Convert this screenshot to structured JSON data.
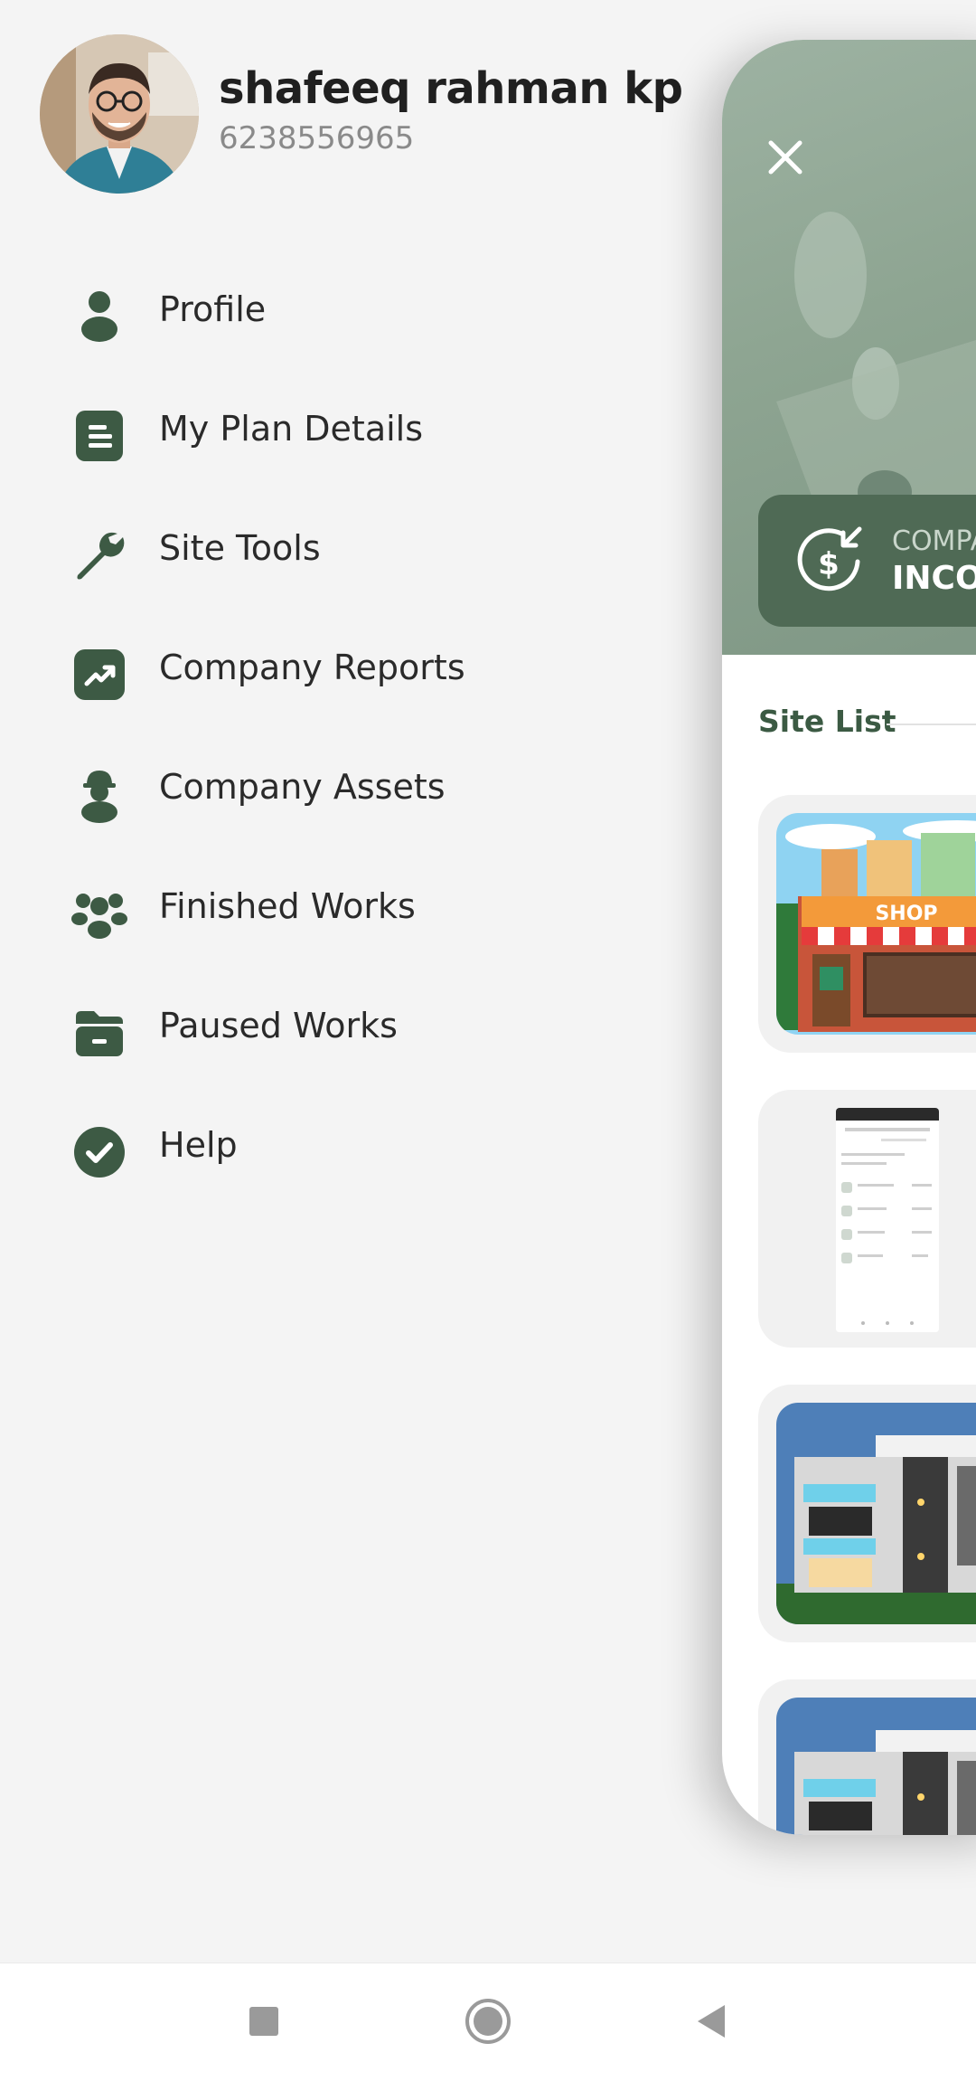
{
  "user": {
    "name": "shafeeq rahman kp",
    "phone": "6238556965"
  },
  "menu": {
    "items": [
      {
        "label": "Profile",
        "icon": "person-icon"
      },
      {
        "label": "My Plan Details",
        "icon": "document-icon"
      },
      {
        "label": "Site Tools",
        "icon": "wrench-icon"
      },
      {
        "label": "Company Reports",
        "icon": "chart-trend-icon"
      },
      {
        "label": "Company Assets",
        "icon": "worker-helmet-icon"
      },
      {
        "label": "Finished Works",
        "icon": "group-icon"
      },
      {
        "label": "Paused Works",
        "icon": "folder-icon"
      },
      {
        "label": "Help",
        "icon": "check-circle-icon"
      }
    ]
  },
  "panel": {
    "income_card": {
      "small_label": "COMPA",
      "big_label": "INCON"
    },
    "site_list": {
      "title": "Site List",
      "items": [
        {
          "thumbnail": "shop-image",
          "sign": "SHOP"
        },
        {
          "thumbnail": "screenshot-image"
        },
        {
          "thumbnail": "house-image"
        },
        {
          "thumbnail": "house-image"
        }
      ]
    }
  },
  "colors": {
    "accent": "#3d5a44",
    "background": "#f4f4f4",
    "card": "#4f6a55"
  },
  "system_nav": [
    "recents-button",
    "home-button",
    "back-button"
  ]
}
